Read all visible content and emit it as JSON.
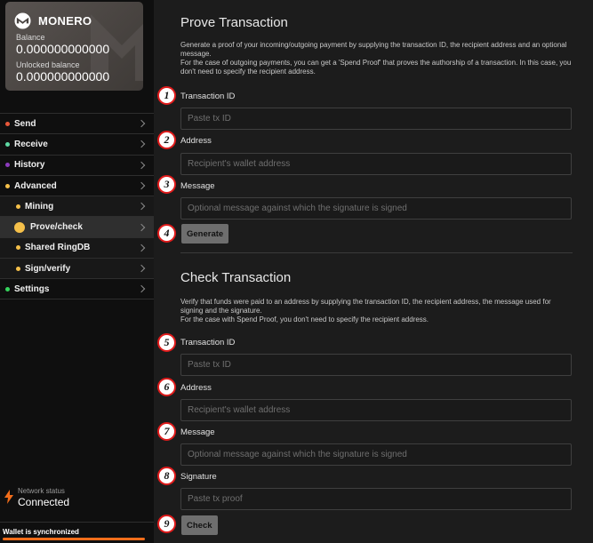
{
  "wallet": {
    "brand": "MONERO",
    "balance_label": "Balance",
    "balance": "0.000000000000",
    "unlocked_label": "Unlocked balance",
    "unlocked_balance": "0.000000000000"
  },
  "menu": [
    {
      "label": "Send",
      "dot": "#e8573a"
    },
    {
      "label": "Receive",
      "dot": "#5ed9a3"
    },
    {
      "label": "History",
      "dot": "#8c3bbd"
    },
    {
      "label": "Advanced",
      "dot": "#f5c04a"
    },
    {
      "label": "Mining",
      "dot": "#f5c04a"
    },
    {
      "label": "Prove/check",
      "dot": "#f5c04a"
    },
    {
      "label": "Shared RingDB",
      "dot": "#f5c04a"
    },
    {
      "label": "Sign/verify",
      "dot": "#f5c04a"
    },
    {
      "label": "Settings",
      "dot": "#35d45d"
    }
  ],
  "network": {
    "label": "Network status",
    "value": "Connected"
  },
  "sync": {
    "label": "Wallet is synchronized",
    "progress": 1.0
  },
  "prove": {
    "title": "Prove Transaction",
    "desc1": "Generate a proof of your incoming/outgoing payment by supplying the transaction ID, the recipient address and an optional message.",
    "desc2": "For the case of outgoing payments, you can get a 'Spend Proof' that proves the authorship of a transaction. In this case, you don't need to specify the recipient address.",
    "txid_label": "Transaction ID",
    "txid_placeholder": "Paste tx ID",
    "address_label": "Address",
    "address_placeholder": "Recipient's wallet address",
    "message_label": "Message",
    "message_placeholder": "Optional message against which the signature is signed",
    "button": "Generate"
  },
  "check": {
    "title": "Check Transaction",
    "desc1": "Verify that funds were paid to an address by supplying the transaction ID, the recipient address, the message used for signing and the signature.",
    "desc2": "For the case with Spend Proof, you don't need to specify the recipient address.",
    "txid_label": "Transaction ID",
    "txid_placeholder": "Paste tx ID",
    "address_label": "Address",
    "address_placeholder": "Recipient's wallet address",
    "message_label": "Message",
    "message_placeholder": "Optional message against which the signature is signed",
    "signature_label": "Signature",
    "signature_placeholder": "Paste tx proof",
    "button": "Check"
  },
  "badges": [
    "1",
    "2",
    "3",
    "4",
    "5",
    "6",
    "7",
    "8",
    "9"
  ],
  "colors": {
    "accent": "#f36d1a",
    "badge_border": "#e01b1b"
  },
  "icons": {
    "logo": "monero-logo-icon",
    "chevron": "chevron-right-icon",
    "network": "lightning-bolt-icon"
  }
}
